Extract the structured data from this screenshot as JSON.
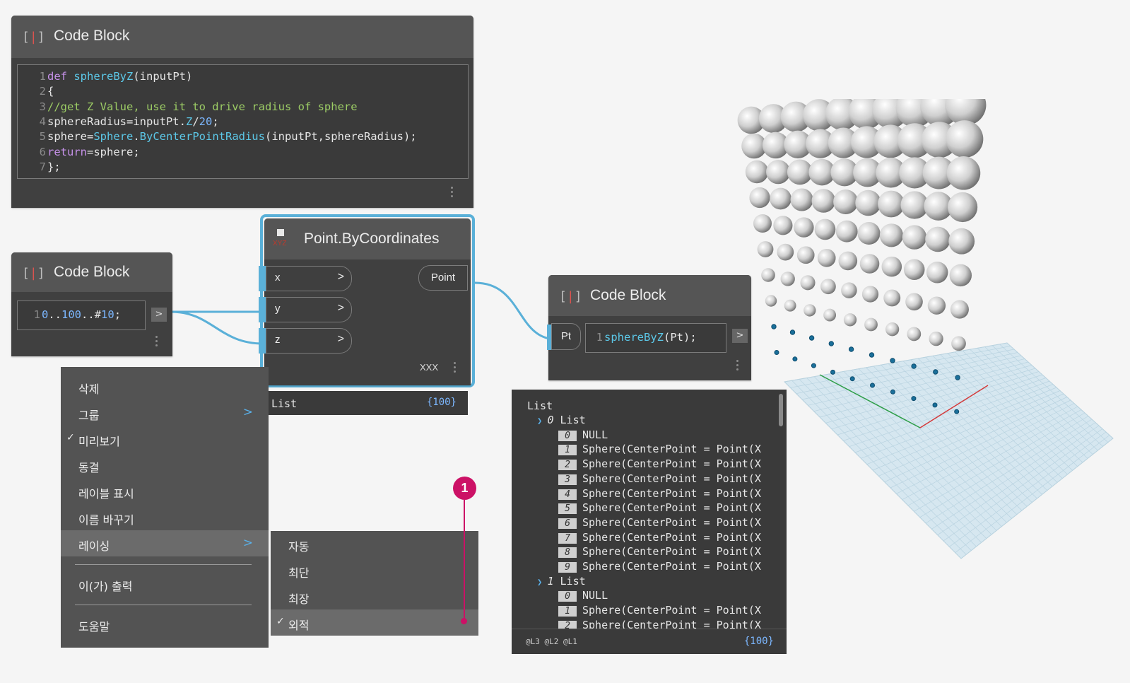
{
  "code_block_main": {
    "icon": "[ ]",
    "title": "Code Block",
    "lines": [
      {
        "n": "1",
        "parts": [
          [
            "kw",
            "def "
          ],
          [
            "fn",
            "sphereByZ"
          ],
          [
            "txt",
            "(inputPt)"
          ]
        ]
      },
      {
        "n": "2",
        "parts": [
          [
            "txt",
            "{"
          ]
        ]
      },
      {
        "n": "3",
        "parts": [
          [
            "cm",
            "//get Z Value, use it to drive radius of sphere"
          ]
        ]
      },
      {
        "n": "4",
        "parts": [
          [
            "txt",
            "sphereRadius=inputPt."
          ],
          [
            "fn",
            "Z"
          ],
          [
            "txt",
            "/"
          ],
          [
            "num",
            "20"
          ],
          [
            "txt",
            ";"
          ]
        ]
      },
      {
        "n": "5",
        "parts": [
          [
            "txt",
            "sphere="
          ],
          [
            "fn",
            "Sphere"
          ],
          [
            "txt",
            "."
          ],
          [
            "fn",
            "ByCenterPointRadius"
          ],
          [
            "txt",
            "(inputPt,sphereRadius);"
          ]
        ]
      },
      {
        "n": "6",
        "parts": [
          [
            "kw",
            "return"
          ],
          [
            "txt",
            "=sphere;"
          ]
        ]
      },
      {
        "n": "7",
        "parts": [
          [
            "txt",
            "};"
          ]
        ]
      }
    ]
  },
  "code_block_range": {
    "icon": "[ ]",
    "title": "Code Block",
    "line_number": "1",
    "code_parts": [
      [
        "num",
        "0"
      ],
      [
        "txt",
        ".."
      ],
      [
        "num",
        "100"
      ],
      [
        "txt",
        ".."
      ],
      [
        "txt",
        "#"
      ],
      [
        "num",
        "10"
      ],
      [
        "txt",
        ";"
      ]
    ],
    "output_port": ">"
  },
  "point_node": {
    "icon_label": "XYZ",
    "title": "Point.ByCoordinates",
    "inputs": [
      {
        "label": "x",
        "arrow": ">"
      },
      {
        "label": "y",
        "arrow": ">"
      },
      {
        "label": "z",
        "arrow": ">"
      }
    ],
    "output": "Point",
    "lacing_label": "XXX",
    "preview_label": "List",
    "preview_count": "{100}"
  },
  "code_block_call": {
    "icon": "[ ]",
    "title": "Code Block",
    "input_port": "Pt",
    "line_number": "1",
    "code_parts": [
      [
        "fn",
        "sphereByZ"
      ],
      [
        "txt",
        "(Pt);"
      ]
    ],
    "output_port": ">"
  },
  "context_menu": {
    "items": [
      {
        "label": "삭제",
        "checked": false,
        "submenu": false
      },
      {
        "label": "그룹",
        "checked": false,
        "submenu": true
      },
      {
        "label": "미리보기",
        "checked": true,
        "submenu": false
      },
      {
        "label": "동결",
        "checked": false,
        "submenu": false
      },
      {
        "label": "레이블 표시",
        "checked": false,
        "submenu": false
      },
      {
        "label": "이름 바꾸기",
        "checked": false,
        "submenu": false
      },
      {
        "label": "레이싱",
        "checked": false,
        "submenu": true,
        "highlighted": true
      }
    ],
    "items_after_sep": [
      {
        "label": "이(가) 출력"
      }
    ],
    "items_after_sep2": [
      {
        "label": "도움말"
      }
    ],
    "check_mark": "✓",
    "submenu_arrow": ">"
  },
  "lacing_submenu": {
    "items": [
      {
        "label": "자동",
        "checked": false
      },
      {
        "label": "최단",
        "checked": false
      },
      {
        "label": "최장",
        "checked": false
      },
      {
        "label": "외적",
        "checked": true
      }
    ]
  },
  "callout": {
    "number": "1",
    "color": "#cc1166"
  },
  "output_preview": {
    "root_label": "List",
    "groups": [
      {
        "index": "0",
        "label": "List",
        "items": [
          {
            "i": "0",
            "text": "NULL"
          },
          {
            "i": "1",
            "text": "Sphere(CenterPoint = Point(X"
          },
          {
            "i": "2",
            "text": "Sphere(CenterPoint = Point(X"
          },
          {
            "i": "3",
            "text": "Sphere(CenterPoint = Point(X"
          },
          {
            "i": "4",
            "text": "Sphere(CenterPoint = Point(X"
          },
          {
            "i": "5",
            "text": "Sphere(CenterPoint = Point(X"
          },
          {
            "i": "6",
            "text": "Sphere(CenterPoint = Point(X"
          },
          {
            "i": "7",
            "text": "Sphere(CenterPoint = Point(X"
          },
          {
            "i": "8",
            "text": "Sphere(CenterPoint = Point(X"
          },
          {
            "i": "9",
            "text": "Sphere(CenterPoint = Point(X"
          }
        ]
      },
      {
        "index": "1",
        "label": "List",
        "items": [
          {
            "i": "0",
            "text": "NULL"
          },
          {
            "i": "1",
            "text": "Sphere(CenterPoint = Point(X"
          },
          {
            "i": "2",
            "text": "Sphere(CenterPoint = Point(X"
          }
        ]
      }
    ],
    "levels": "@L3 @L2 @L1",
    "count": "{100}"
  },
  "colors": {
    "wire": "#5ab0d8",
    "accent": "#5ab0d8",
    "callout": "#cc1166",
    "node_bg": "#404040"
  }
}
